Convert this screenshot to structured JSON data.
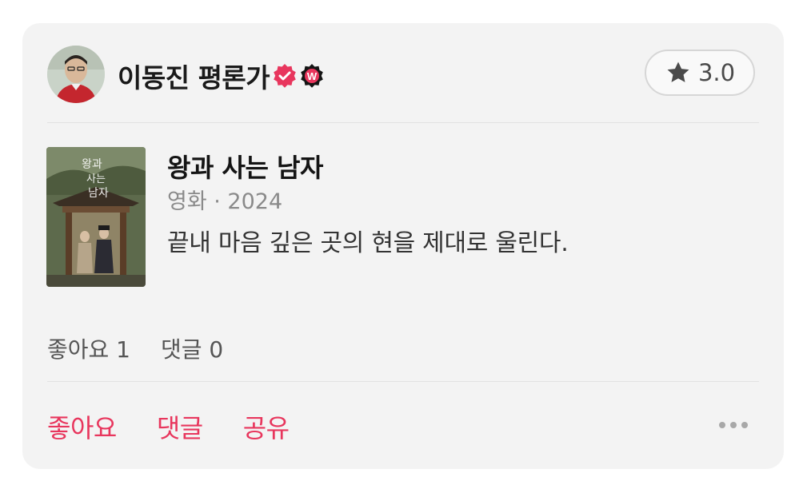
{
  "author": {
    "name": "이동진 평론가",
    "verified_icon": "verified-check-icon",
    "badge_icon": "watcha-w-badge-icon",
    "badge_letter": "W",
    "accent": "#e8365d"
  },
  "rating": {
    "icon": "star-icon",
    "value": "3.0"
  },
  "movie": {
    "title": "왕과 사는 남자",
    "meta": "영화 · 2024",
    "review": "끝내 마음 깊은 곳의 현을 제대로 울린다."
  },
  "stats": {
    "likes": "좋아요 1",
    "comments": "댓글 0"
  },
  "actions": {
    "like": "좋아요",
    "comment": "댓글",
    "share": "공유",
    "more_icon": "more-dots-icon"
  },
  "colors": {
    "card_bg": "#f3f3f3",
    "accent": "#e8365d"
  }
}
